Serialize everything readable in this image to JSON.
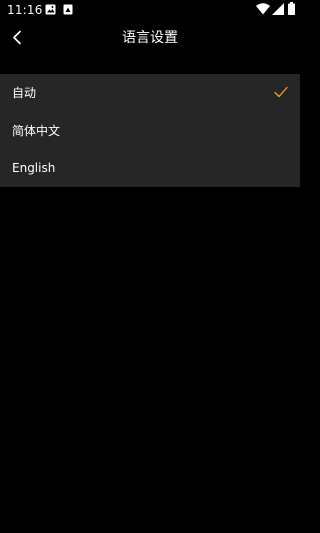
{
  "status_bar": {
    "time": "11:16",
    "left_icons": [
      "image-notification-icon",
      "download-notification-icon"
    ],
    "right_icons": [
      "wifi-icon",
      "signal-icon",
      "battery-icon"
    ]
  },
  "header": {
    "title": "语言设置",
    "back_icon": "chevron-left-icon"
  },
  "languages": [
    {
      "label": "自动",
      "selected": true
    },
    {
      "label": "简体中文",
      "selected": false
    },
    {
      "label": "English",
      "selected": false
    }
  ],
  "colors": {
    "background": "#000000",
    "list_background": "#262626",
    "text": "#ffffff",
    "accent_check": "#f0a030"
  }
}
